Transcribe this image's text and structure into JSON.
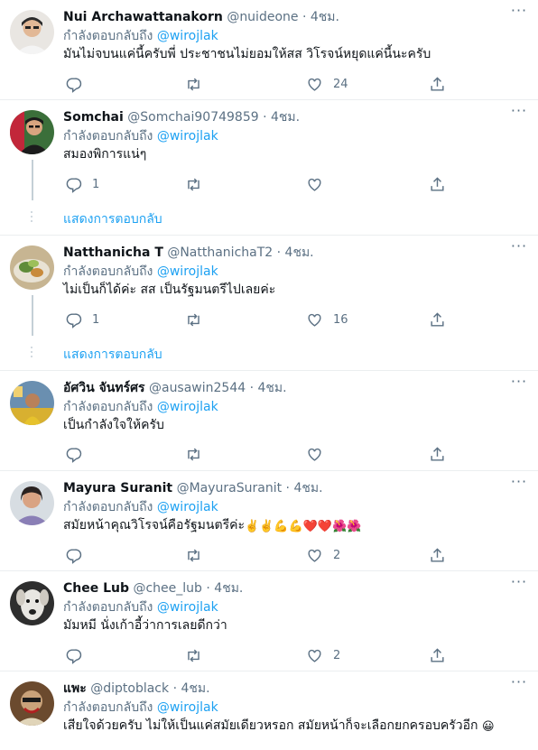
{
  "reply_prefix": "กำลังตอบกลับถึง",
  "show_replies": "แสดงการตอบกลับ",
  "tweets": [
    {
      "name": "Nui Archawattanakorn",
      "handle": "@nuideone",
      "time": "4ชม.",
      "mention": "@wirojlak",
      "text": "มันไม่จบนแค่นี้ครับพี่ ประชาชนไม่ยอมให้สส วิโรจน์หยุดแค่นี้นะครับ",
      "replies": "",
      "likes": "24"
    },
    {
      "name": "Somchai",
      "handle": "@Somchai90749859",
      "time": "4ชม.",
      "mention": "@wirojlak",
      "text": "สมองพิการแน่ๆ",
      "replies": "1",
      "likes": ""
    },
    {
      "name": "Natthanicha T",
      "handle": "@NatthanichaT2",
      "time": "4ชม.",
      "mention": "@wirojlak",
      "text": "ไม่เป็นก็ได้ค่ะ สส เป็นรัฐมนตรีไปเลยค่ะ",
      "replies": "1",
      "likes": "16"
    },
    {
      "name": "อัศวิน จันทร์ศร",
      "handle": "@ausawin2544",
      "time": "4ชม.",
      "mention": "@wirojlak",
      "text": "เป็นกำลังใจให้ครับ",
      "replies": "",
      "likes": ""
    },
    {
      "name": "Mayura Suranit",
      "handle": "@MayuraSuranit",
      "time": "4ชม.",
      "mention": "@wirojlak",
      "text": "สมัยหน้าคุณวิโรจน์คือรัฐมนตรีค่ะ",
      "emoji": "✌️✌️💪💪❤️❤️🌺🌺",
      "replies": "",
      "likes": "2"
    },
    {
      "name": "Chee Lub",
      "handle": "@chee_lub",
      "time": "4ชม.",
      "mention": "@wirojlak",
      "text": "มัมหมี นั่งเก้าอี้ว่าการเลยดีกว่า",
      "replies": "",
      "likes": "2"
    },
    {
      "name": "แพะ",
      "handle": "@diptoblack",
      "time": "4ชม.",
      "mention": "@wirojlak",
      "text": "เสียใจด้วยครับ ไม่ให้เป็นแค่สมัยเดียวหรอก สมัยหน้าก็จะเลือกยกครอบครัวอีก",
      "emoji": "😀",
      "replies": "",
      "likes": ""
    }
  ]
}
